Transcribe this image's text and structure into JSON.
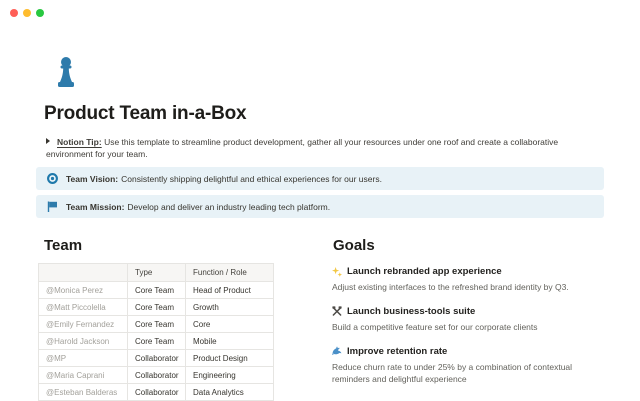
{
  "window": {
    "traffic_lights": {
      "close": "#ff5f57",
      "minimize": "#febc2e",
      "zoom": "#28c840"
    }
  },
  "page": {
    "icon": "pawn-icon",
    "title": "Product Team in-a-Box",
    "tip": {
      "label": "Notion Tip:",
      "text": " Use this template to streamline product development, gather all your resources under one roof and create a collaborative environment for your team."
    },
    "callouts": [
      {
        "icon": "target-icon",
        "label": "Team Vision:",
        "text": " Consistently shipping delightful and ethical experiences for our users."
      },
      {
        "icon": "flag-icon",
        "label": "Team Mission:",
        "text": " Develop and deliver an industry leading tech platform."
      }
    ]
  },
  "team": {
    "heading": "Team",
    "table": {
      "headers": [
        "",
        "Type",
        "Function / Role"
      ],
      "rows": [
        [
          "@Monica Perez",
          "Core Team",
          "Head of Product"
        ],
        [
          "@Matt Piccolella",
          "Core Team",
          "Growth"
        ],
        [
          "@Emily Fernandez",
          "Core Team",
          "Core"
        ],
        [
          "@Harold Jackson",
          "Core Team",
          "Mobile"
        ],
        [
          "@MP",
          "Collaborator",
          "Product Design"
        ],
        [
          "@Maria Caprani",
          "Collaborator",
          "Engineering"
        ],
        [
          "@Esteban Balderas",
          "Collaborator",
          "Data Analytics"
        ]
      ]
    }
  },
  "goals": {
    "heading": "Goals",
    "items": [
      {
        "icon": "sparkles-icon",
        "title": "Launch rebranded app experience",
        "description": "Adjust existing interfaces to the refreshed brand identity by Q3."
      },
      {
        "icon": "tools-icon",
        "title": "Launch business-tools suite",
        "description": "Build a competitive feature set for our corporate clients"
      },
      {
        "icon": "dolphin-icon",
        "title": "Improve retention rate",
        "description": "Reduce churn rate to under 25% by a combination of contextual reminders and delightful experience"
      }
    ]
  },
  "colors": {
    "accent_blue": "#2e7bab",
    "callout_bg": "#e8f2f7",
    "text_primary": "#37352f",
    "text_muted": "#a3a19b",
    "sparkle_yellow": "#f2c744"
  }
}
